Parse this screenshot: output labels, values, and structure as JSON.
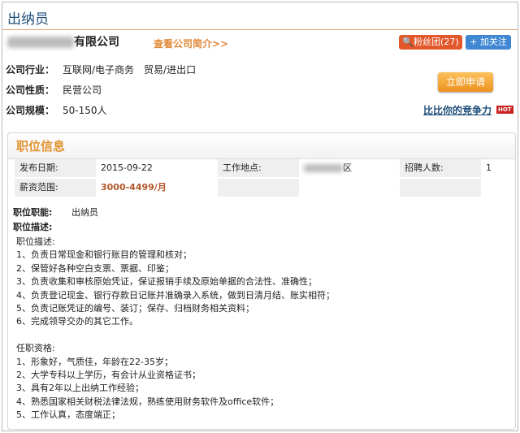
{
  "page_title": "出纳员",
  "company": {
    "name_suffix": "有限公司",
    "intro_link": "查看公司简介>>",
    "fans_button": "粉丝团(27)",
    "follow_button": "+ 加关注",
    "apply_button": "立即申请",
    "compete_link": "比比你的竞争力",
    "hot_badge": "HOT",
    "industry_label": "公司行业：",
    "industry_value": "互联网/电子商务　贸易/进出口",
    "nature_label": "公司性质：",
    "nature_value": "民营公司",
    "size_label": "公司规模：",
    "size_value": "50-150人"
  },
  "job": {
    "section_title": "职位信息",
    "date_label": "发布日期:",
    "date_value": "2015-09-22",
    "location_label": "工作地点:",
    "location_value": "区",
    "headcount_label": "招聘人数:",
    "headcount_value": "1",
    "salary_label": "薪资范围:",
    "salary_value": "3000-4499/月",
    "function_label": "职位职能:",
    "function_value": "出纳员",
    "desc_label": "职位描述:",
    "lines": [
      "职位描述:",
      "1、负责日常现金和银行账目的管理和核对；",
      "2、保管好各种空白支票、票据、印鉴；",
      "3、负责收集和审核原始凭证，保证报销手续及原始单据的合法性、准确性；",
      "4、负责登记现金、银行存款日记账并准确录入系统，做到日清月结、账实相符；",
      "5、负责记账凭证的编号、装订；保存、归档财务相关资料；",
      "6、完成领导交办的其它工作。",
      "",
      "任职资格:",
      "1、形象好，气质佳，年龄在22-35岁；",
      "2、大学专科以上学历，有会计从业资格证书；",
      "3、具有2年以上出纳工作经验；",
      "4、熟悉国家相关财税法律法规，熟练使用财务软件及office软件；",
      "5、工作认真，态度端正；"
    ]
  }
}
